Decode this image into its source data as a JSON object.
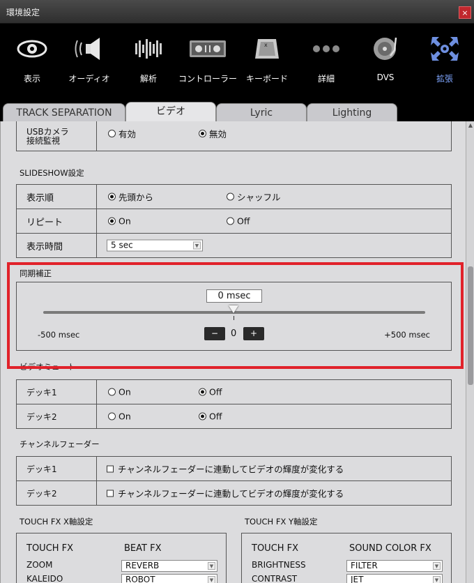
{
  "window": {
    "title": "環境設定",
    "close_label": "×"
  },
  "categories": [
    {
      "label": "表示",
      "icon": "eye-icon"
    },
    {
      "label": "オーディオ",
      "icon": "speaker-icon"
    },
    {
      "label": "解析",
      "icon": "waveform-icon"
    },
    {
      "label": "コントローラー",
      "icon": "controller-icon"
    },
    {
      "label": "キーボード",
      "icon": "keyboard-icon"
    },
    {
      "label": "詳細",
      "icon": "dots-icon"
    },
    {
      "label": "DVS",
      "icon": "turntable-icon"
    },
    {
      "label": "拡張",
      "icon": "expand-icon",
      "active": true
    }
  ],
  "tabs": [
    {
      "label": "TRACK SEPARATION"
    },
    {
      "label": "ビデオ",
      "active": true
    },
    {
      "label": "Lyric"
    },
    {
      "label": "Lighting"
    }
  ],
  "usb_camera": {
    "label": "USBカメラ\n接続監視",
    "options": [
      "有効",
      "無効"
    ],
    "selected": "無効"
  },
  "slideshow": {
    "title": "SLIDESHOW設定",
    "order": {
      "label": "表示順",
      "options": [
        "先頭から",
        "シャッフル"
      ],
      "selected": "先頭から"
    },
    "repeat": {
      "label": "リピート",
      "options": [
        "On",
        "Off"
      ],
      "selected": "On"
    },
    "duration": {
      "label": "表示時間",
      "value": "5 sec"
    }
  },
  "sync": {
    "title": "同期補正",
    "field_value": "0 msec",
    "min_label": "-500 msec",
    "max_label": "+500 msec",
    "minus_label": "−",
    "plus_label": "+",
    "value": "0"
  },
  "video_mute": {
    "title": "ビデオミュート",
    "deck1": {
      "label": "デッキ1",
      "options": [
        "On",
        "Off"
      ],
      "selected": "Off"
    },
    "deck2": {
      "label": "デッキ2",
      "options": [
        "On",
        "Off"
      ],
      "selected": "Off"
    }
  },
  "channel_fader": {
    "title": "チャンネルフェーダー",
    "deck1": {
      "label": "デッキ1",
      "checkbox_label": "チャンネルフェーダーに連動してビデオの輝度が変化する"
    },
    "deck2": {
      "label": "デッキ2",
      "checkbox_label": "チャンネルフェーダーに連動してビデオの輝度が変化する"
    }
  },
  "touch_fx_x": {
    "title": "TOUCH FX X軸設定",
    "col1": "TOUCH FX",
    "col2": "BEAT FX",
    "rows": [
      {
        "label": "ZOOM",
        "value": "REVERB"
      },
      {
        "label": "KALEIDO",
        "value": "ROBOT"
      }
    ]
  },
  "touch_fx_y": {
    "title": "TOUCH FX Y軸設定",
    "col1": "TOUCH FX",
    "col2": "SOUND COLOR FX",
    "rows": [
      {
        "label": "BRIGHTNESS",
        "value": "FILTER"
      },
      {
        "label": "CONTRAST",
        "value": "JET"
      }
    ]
  },
  "colors": {
    "highlight": "#e1222a",
    "active_category": "#7fa6ff"
  }
}
